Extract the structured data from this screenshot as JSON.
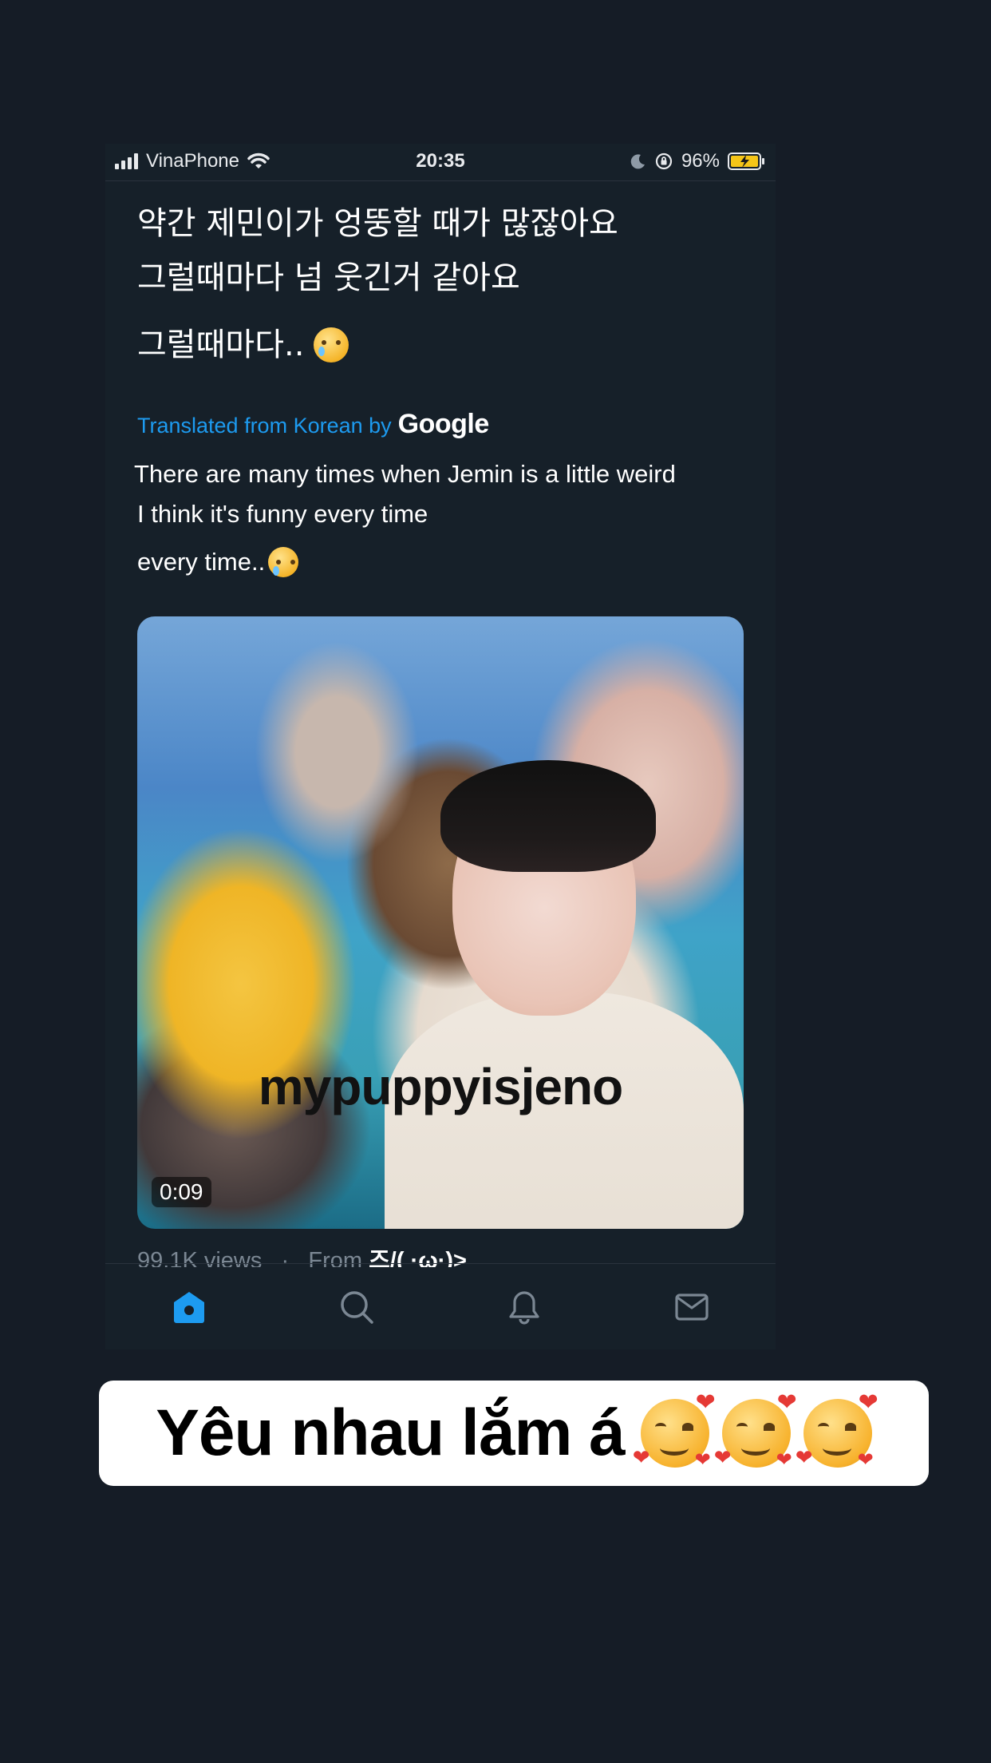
{
  "status_bar": {
    "carrier": "VinaPhone",
    "time": "20:35",
    "battery": "96%"
  },
  "tweet": {
    "original_lines": [
      "약간 제민이가 엉뚱할 때가 많잖아요",
      "그럴때마다 넘 웃긴거 같아요",
      "그럴때마다.."
    ],
    "translated_label": "Translated from Korean by",
    "translator_brand": "Google",
    "translation_lines": [
      "There are many times when Jemin is a little weird",
      " I think it's funny every time",
      " every time.."
    ],
    "media": {
      "watermark": "mypuppyisjeno",
      "duration": "0:09"
    },
    "meta": {
      "views": "99.1K views",
      "separator": "·",
      "from_label": "From",
      "from_user": "즈/( ·ω·)>"
    }
  },
  "tabbar": {
    "items": [
      "home-icon",
      "search-icon",
      "notifications-icon",
      "messages-icon"
    ],
    "active_color": "#1d9bf0",
    "inactive_color": "#7b8793"
  },
  "caption": {
    "text": "Yêu nhau lắm á"
  },
  "colors": {
    "background": "#151c26",
    "card": "#162029",
    "accent": "#1d9bf0"
  }
}
